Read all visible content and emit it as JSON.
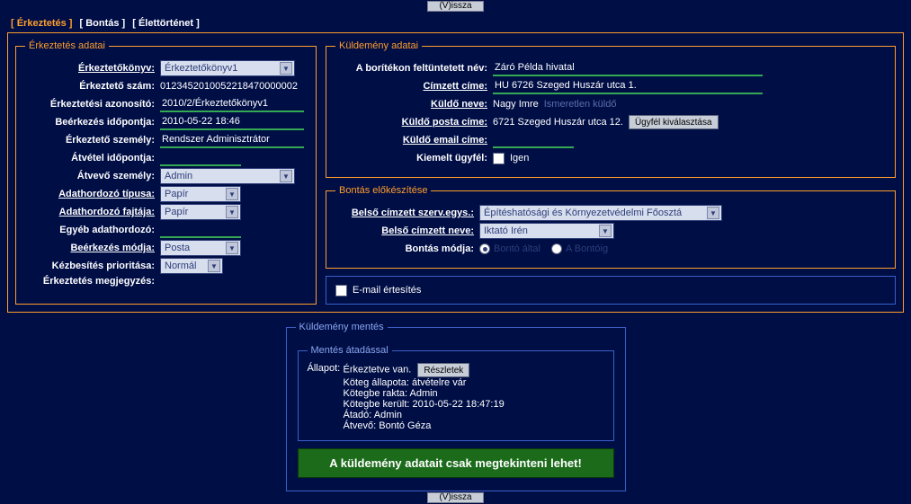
{
  "nav": {
    "vissza": "(V)issza"
  },
  "tabs": {
    "erkeztetes": "[ Érkeztetés ]",
    "bontas": "[ Bontás ]",
    "elettortenet": "[ Élettörténet ]"
  },
  "erk": {
    "legend": "Érkeztetés adatai",
    "konyv_lbl": "Érkeztetőkönyv:",
    "konyv_val": "Érkeztetőkönyv1",
    "szam_lbl": "Érkeztető szám:",
    "szam_val": "0123452010052218470000002",
    "azon_lbl": "Érkeztetési azonosító:",
    "azon_val": "2010/2/Érkeztetőkönyv1",
    "beerk_lbl": "Beérkezés időpontja:",
    "beerk_val": "2010-05-22 18:46",
    "erksz_lbl": "Érkeztető személy:",
    "erksz_val": "Rendszer Adminisztrátor",
    "atvido_lbl": "Átvétel időpontja:",
    "atvido_val": "",
    "atvsz_lbl": "Átvevő személy:",
    "atvsz_val": "Admin",
    "adtip_lbl": "Adathordozó típusa:",
    "adtip_val": "Papír",
    "adfajta_lbl": "Adathordozó fajtája:",
    "adfajta_val": "Papír",
    "egyeb_lbl": "Egyéb adathordozó:",
    "egyeb_val": "",
    "beerkm_lbl": "Beérkezés módja:",
    "beerkm_val": "Posta",
    "kprio_lbl": "Kézbesítés prioritása:",
    "kprio_val": "Normál",
    "megj_lbl": "Érkeztetés megjegyzés:"
  },
  "kuld": {
    "legend": "Küldemény adatai",
    "boritek_lbl": "A borítékon feltüntetett név:",
    "boritek_val": "Záró Példa hivatal",
    "cimzett_lbl": "Címzett címe:",
    "cimzett_val": "HU 6726 Szeged Huszár utca 1.",
    "kuldnev_lbl": "Küldő neve:",
    "kuldnev_val": "Nagy Imre",
    "ismeretlen": "Ismeretlen küldő",
    "kuldposta_lbl": "Küldő posta címe:",
    "kuldposta_val": "6721 Szeged Huszár utca 12.",
    "ugyfel_btn": "Ügyfél kiválasztása",
    "kuldemail_lbl": "Küldő email címe:",
    "kiemelt_lbl": "Kiemelt ügyfél:",
    "igen": "Igen"
  },
  "bont": {
    "legend": "Bontás előkészítése",
    "szerv_lbl": "Belső címzett szerv.egys.:",
    "szerv_val": "Építéshatósági és Környezetvédelmi Főosztá",
    "nev_lbl": "Belső címzett neve:",
    "nev_val": "Iktató Irén",
    "mod_lbl": "Bontás módja:",
    "opt1": "Bontó által",
    "opt2": "A Bontóig"
  },
  "email": {
    "label": "E-mail értesítés"
  },
  "save": {
    "legend_outer": "Küldemény mentés",
    "legend_inner": "Mentés átadással",
    "allapot": "Állapot:",
    "line1_lbl": "Érkeztetve van.",
    "reszletek_btn": "Részletek",
    "line2": "Köteg állapota: átvételre vár",
    "line3": "Kötegbe rakta: Admin",
    "line4": "Kötegbe került: 2010-05-22 18:47:19",
    "line5": "Átadó: Admin",
    "line6": "Átvevő: Bontó Géza",
    "banner": "A küldemény adatait csak megtekinteni lehet!"
  }
}
